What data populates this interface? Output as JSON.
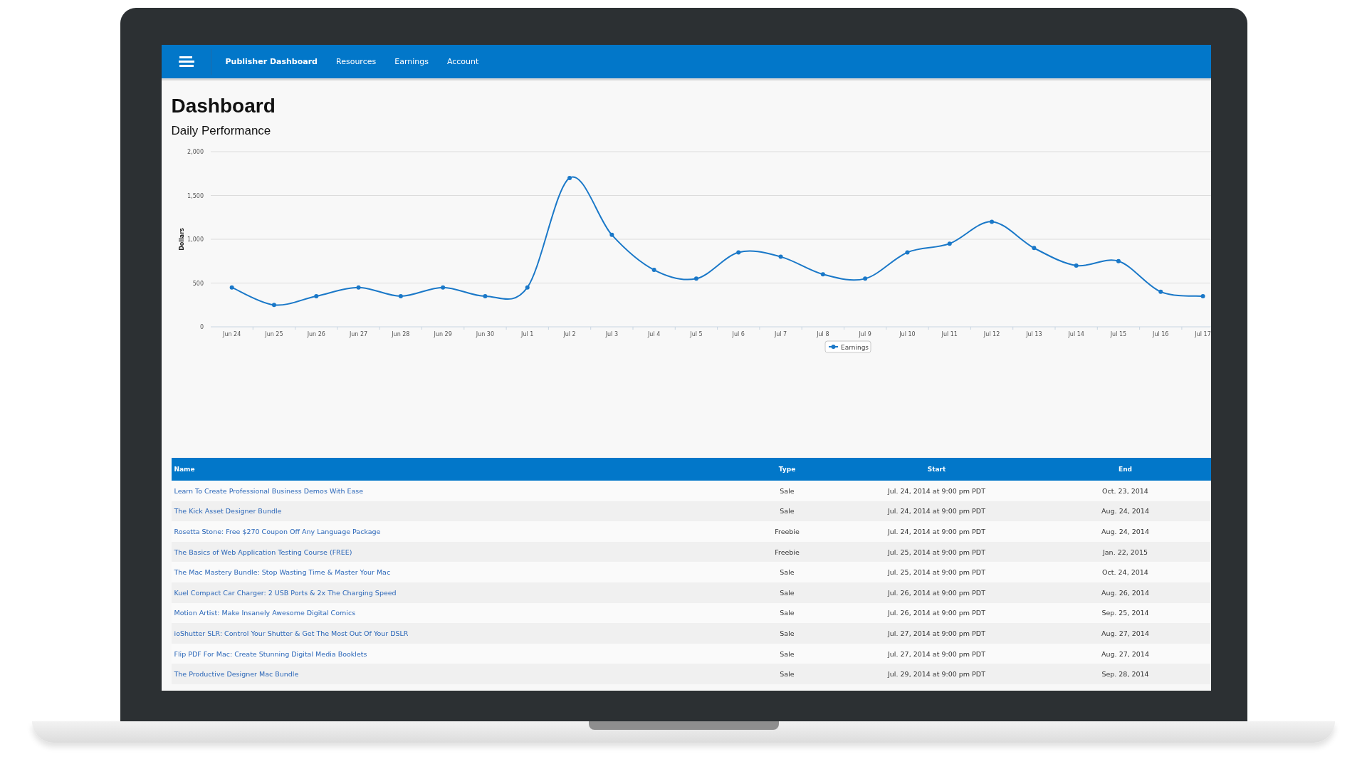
{
  "nav": {
    "brand": "Publisher Dashboard",
    "items": [
      "Resources",
      "Earnings",
      "Account"
    ]
  },
  "page": {
    "title": "Dashboard",
    "subtitle": "Daily Performance"
  },
  "chart": {
    "chart_data": {
      "type": "line",
      "ylabel": "Dollars",
      "categories": [
        "Jun 24",
        "Jun 25",
        "Jun 26",
        "Jun 27",
        "Jun 28",
        "Jun 29",
        "Jun 30",
        "Jul 1",
        "Jul 2",
        "Jul 3",
        "Jul 4",
        "Jul 5",
        "Jul 6",
        "Jul 7",
        "Jul 8",
        "Jul 9",
        "Jul 10",
        "Jul 11",
        "Jul 12",
        "Jul 13",
        "Jul 14",
        "Jul 15",
        "Jul 16",
        "Jul 17"
      ],
      "series": [
        {
          "name": "Earnings",
          "color": "#1a78c8",
          "values": [
            450,
            250,
            350,
            450,
            350,
            450,
            350,
            450,
            1700,
            1050,
            650,
            550,
            850,
            800,
            600,
            550,
            850,
            950,
            1200,
            900,
            700,
            750,
            400,
            350
          ],
          "marker": true
        }
      ],
      "grid": true,
      "ylim": [
        0,
        2000
      ],
      "yticks": [
        {
          "value": 0,
          "label": "0"
        },
        {
          "value": 500,
          "label": "500"
        },
        {
          "value": 1000,
          "label": "1,000"
        },
        {
          "value": 1500,
          "label": "1,500"
        },
        {
          "value": 2000,
          "label": "2,000"
        }
      ]
    }
  },
  "table": {
    "columns": [
      "Name",
      "Type",
      "Start",
      "End"
    ],
    "rows": [
      {
        "name": "Learn To Create Professional Business Demos With Ease",
        "type": "Sale",
        "start": "Jul. 24, 2014 at 9:00 pm PDT",
        "end": "Oct. 23, 2014"
      },
      {
        "name": "The Kick Asset Designer Bundle",
        "type": "Sale",
        "start": "Jul. 24, 2014 at 9:00 pm PDT",
        "end": "Aug. 24, 2014"
      },
      {
        "name": "Rosetta Stone: Free $270 Coupon Off Any Language Package",
        "type": "Freebie",
        "start": "Jul. 24, 2014 at 9:00 pm PDT",
        "end": "Aug. 24, 2014"
      },
      {
        "name": "The Basics of Web Application Testing Course (FREE)",
        "type": "Freebie",
        "start": "Jul. 25, 2014 at 9:00 pm PDT",
        "end": "Jan. 22, 2015"
      },
      {
        "name": "The Mac Mastery Bundle: Stop Wasting Time & Master Your Mac",
        "type": "Sale",
        "start": "Jul. 25, 2014 at 9:00 pm PDT",
        "end": "Oct. 24, 2014"
      },
      {
        "name": "Kuel Compact Car Charger: 2 USB Ports & 2x The Charging Speed",
        "type": "Sale",
        "start": "Jul. 26, 2014 at 9:00 pm PDT",
        "end": "Aug. 26, 2014"
      },
      {
        "name": "Motion Artist: Make Insanely Awesome Digital Comics",
        "type": "Sale",
        "start": "Jul. 26, 2014 at 9:00 pm PDT",
        "end": "Sep. 25, 2014"
      },
      {
        "name": "ioShutter SLR: Control Your Shutter & Get The Most Out Of Your DSLR",
        "type": "Sale",
        "start": "Jul. 27, 2014 at 9:00 pm PDT",
        "end": "Aug. 27, 2014"
      },
      {
        "name": "Flip PDF For Mac: Create Stunning Digital Media Booklets",
        "type": "Sale",
        "start": "Jul. 27, 2014 at 9:00 pm PDT",
        "end": "Aug. 27, 2014"
      },
      {
        "name": "The Productive Designer Mac Bundle",
        "type": "Sale",
        "start": "Jul. 29, 2014 at 9:00 pm PDT",
        "end": "Sep. 28, 2014"
      }
    ]
  }
}
